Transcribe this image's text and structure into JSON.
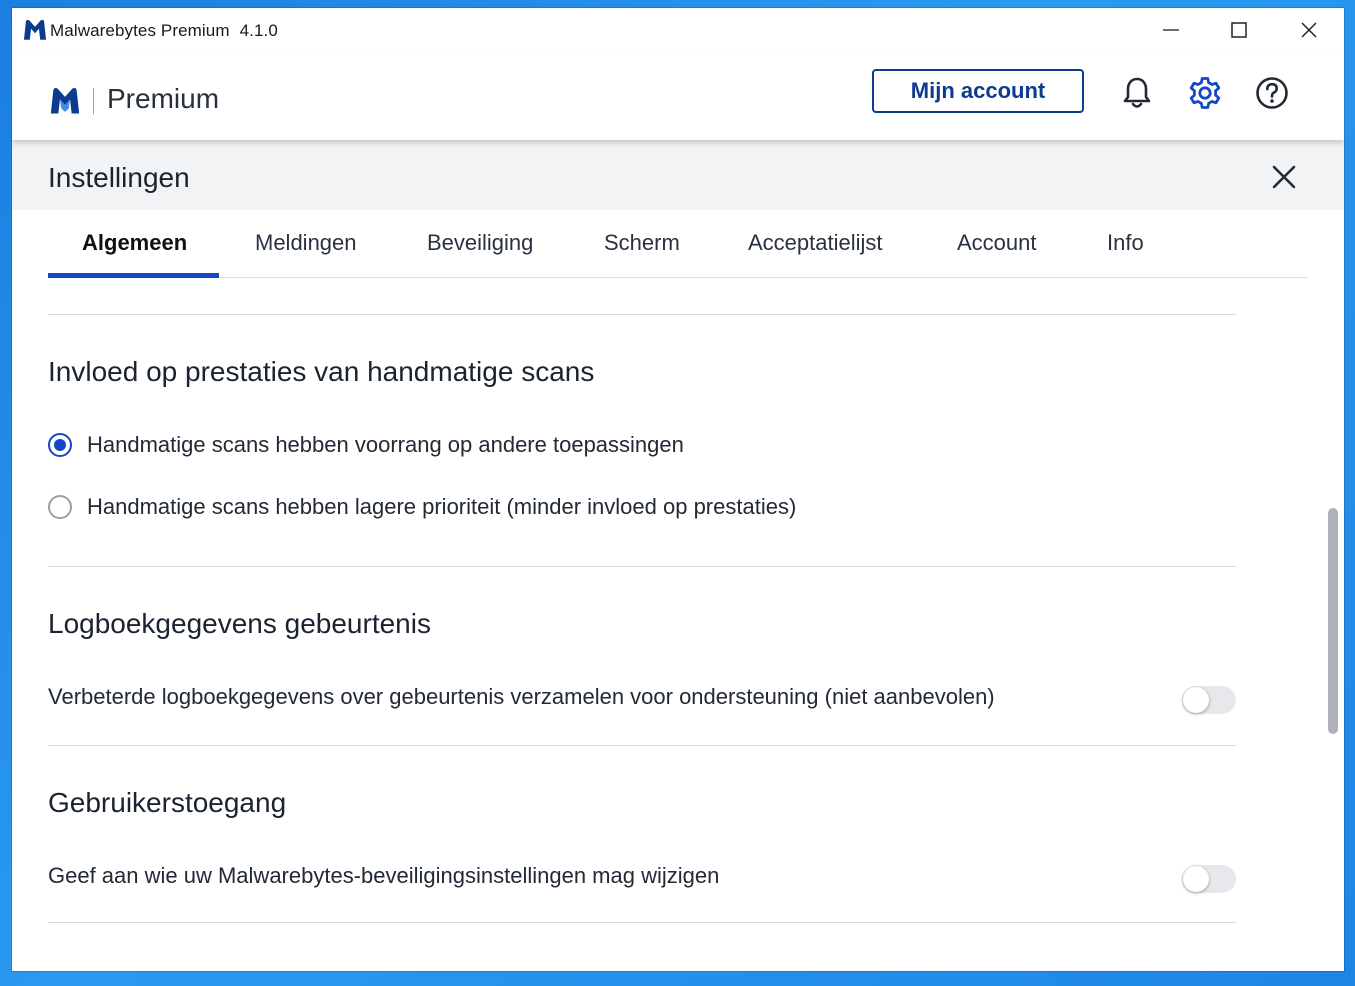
{
  "window": {
    "app_name": "Malwarebytes Premium",
    "version": "4.1.0",
    "controls": {
      "minimize_icon": "minimize-icon",
      "maximize_icon": "maximize-icon",
      "close_icon": "close-icon"
    }
  },
  "header": {
    "product": "Premium",
    "account_button": "Mijn account",
    "icons": [
      "bell-icon",
      "gear-icon",
      "help-icon"
    ]
  },
  "settings": {
    "title": "Instellingen",
    "close_icon": "close-icon",
    "tabs": [
      {
        "label": "Algemeen",
        "active": true
      },
      {
        "label": "Meldingen",
        "active": false
      },
      {
        "label": "Beveiliging",
        "active": false
      },
      {
        "label": "Scherm",
        "active": false
      },
      {
        "label": "Acceptatielijst",
        "active": false
      },
      {
        "label": "Account",
        "active": false
      },
      {
        "label": "Info",
        "active": false
      }
    ]
  },
  "sections": {
    "performance": {
      "title": "Invloed op prestaties van handmatige scans",
      "options": [
        {
          "label": "Handmatige scans hebben voorrang op andere toepassingen",
          "selected": true
        },
        {
          "label": "Handmatige scans hebben lagere prioriteit (minder invloed op prestaties)",
          "selected": false
        }
      ]
    },
    "logging": {
      "title": "Logboekgegevens gebeurtenis",
      "setting": "Verbeterde logboekgegevens over gebeurtenis verzamelen voor ondersteuning (niet aanbevolen)",
      "enabled": false
    },
    "user_access": {
      "title": "Gebruikerstoegang",
      "setting": "Geef aan wie uw Malwarebytes-beveiligingsinstellingen mag wijzigen",
      "enabled": false
    }
  },
  "colors": {
    "accent": "#1547c8",
    "brand_navy": "#0d3c8f",
    "toggle_off": "#e6e8ec"
  }
}
